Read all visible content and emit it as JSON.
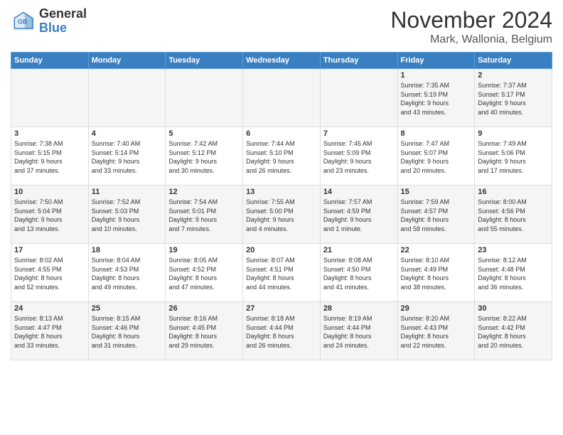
{
  "header": {
    "logo_line1": "General",
    "logo_line2": "Blue",
    "title": "November 2024",
    "subtitle": "Mark, Wallonia, Belgium"
  },
  "calendar": {
    "headers": [
      "Sunday",
      "Monday",
      "Tuesday",
      "Wednesday",
      "Thursday",
      "Friday",
      "Saturday"
    ],
    "weeks": [
      [
        {
          "day": "",
          "info": ""
        },
        {
          "day": "",
          "info": ""
        },
        {
          "day": "",
          "info": ""
        },
        {
          "day": "",
          "info": ""
        },
        {
          "day": "",
          "info": ""
        },
        {
          "day": "1",
          "info": "Sunrise: 7:35 AM\nSunset: 5:19 PM\nDaylight: 9 hours\nand 43 minutes."
        },
        {
          "day": "2",
          "info": "Sunrise: 7:37 AM\nSunset: 5:17 PM\nDaylight: 9 hours\nand 40 minutes."
        }
      ],
      [
        {
          "day": "3",
          "info": "Sunrise: 7:38 AM\nSunset: 5:15 PM\nDaylight: 9 hours\nand 37 minutes."
        },
        {
          "day": "4",
          "info": "Sunrise: 7:40 AM\nSunset: 5:14 PM\nDaylight: 9 hours\nand 33 minutes."
        },
        {
          "day": "5",
          "info": "Sunrise: 7:42 AM\nSunset: 5:12 PM\nDaylight: 9 hours\nand 30 minutes."
        },
        {
          "day": "6",
          "info": "Sunrise: 7:44 AM\nSunset: 5:10 PM\nDaylight: 9 hours\nand 26 minutes."
        },
        {
          "day": "7",
          "info": "Sunrise: 7:45 AM\nSunset: 5:09 PM\nDaylight: 9 hours\nand 23 minutes."
        },
        {
          "day": "8",
          "info": "Sunrise: 7:47 AM\nSunset: 5:07 PM\nDaylight: 9 hours\nand 20 minutes."
        },
        {
          "day": "9",
          "info": "Sunrise: 7:49 AM\nSunset: 5:06 PM\nDaylight: 9 hours\nand 17 minutes."
        }
      ],
      [
        {
          "day": "10",
          "info": "Sunrise: 7:50 AM\nSunset: 5:04 PM\nDaylight: 9 hours\nand 13 minutes."
        },
        {
          "day": "11",
          "info": "Sunrise: 7:52 AM\nSunset: 5:03 PM\nDaylight: 9 hours\nand 10 minutes."
        },
        {
          "day": "12",
          "info": "Sunrise: 7:54 AM\nSunset: 5:01 PM\nDaylight: 9 hours\nand 7 minutes."
        },
        {
          "day": "13",
          "info": "Sunrise: 7:55 AM\nSunset: 5:00 PM\nDaylight: 9 hours\nand 4 minutes."
        },
        {
          "day": "14",
          "info": "Sunrise: 7:57 AM\nSunset: 4:59 PM\nDaylight: 9 hours\nand 1 minute."
        },
        {
          "day": "15",
          "info": "Sunrise: 7:59 AM\nSunset: 4:57 PM\nDaylight: 8 hours\nand 58 minutes."
        },
        {
          "day": "16",
          "info": "Sunrise: 8:00 AM\nSunset: 4:56 PM\nDaylight: 8 hours\nand 55 minutes."
        }
      ],
      [
        {
          "day": "17",
          "info": "Sunrise: 8:02 AM\nSunset: 4:55 PM\nDaylight: 8 hours\nand 52 minutes."
        },
        {
          "day": "18",
          "info": "Sunrise: 8:04 AM\nSunset: 4:53 PM\nDaylight: 8 hours\nand 49 minutes."
        },
        {
          "day": "19",
          "info": "Sunrise: 8:05 AM\nSunset: 4:52 PM\nDaylight: 8 hours\nand 47 minutes."
        },
        {
          "day": "20",
          "info": "Sunrise: 8:07 AM\nSunset: 4:51 PM\nDaylight: 8 hours\nand 44 minutes."
        },
        {
          "day": "21",
          "info": "Sunrise: 8:08 AM\nSunset: 4:50 PM\nDaylight: 8 hours\nand 41 minutes."
        },
        {
          "day": "22",
          "info": "Sunrise: 8:10 AM\nSunset: 4:49 PM\nDaylight: 8 hours\nand 38 minutes."
        },
        {
          "day": "23",
          "info": "Sunrise: 8:12 AM\nSunset: 4:48 PM\nDaylight: 8 hours\nand 36 minutes."
        }
      ],
      [
        {
          "day": "24",
          "info": "Sunrise: 8:13 AM\nSunset: 4:47 PM\nDaylight: 8 hours\nand 33 minutes."
        },
        {
          "day": "25",
          "info": "Sunrise: 8:15 AM\nSunset: 4:46 PM\nDaylight: 8 hours\nand 31 minutes."
        },
        {
          "day": "26",
          "info": "Sunrise: 8:16 AM\nSunset: 4:45 PM\nDaylight: 8 hours\nand 29 minutes."
        },
        {
          "day": "27",
          "info": "Sunrise: 8:18 AM\nSunset: 4:44 PM\nDaylight: 8 hours\nand 26 minutes."
        },
        {
          "day": "28",
          "info": "Sunrise: 8:19 AM\nSunset: 4:44 PM\nDaylight: 8 hours\nand 24 minutes."
        },
        {
          "day": "29",
          "info": "Sunrise: 8:20 AM\nSunset: 4:43 PM\nDaylight: 8 hours\nand 22 minutes."
        },
        {
          "day": "30",
          "info": "Sunrise: 8:22 AM\nSunset: 4:42 PM\nDaylight: 8 hours\nand 20 minutes."
        }
      ]
    ]
  }
}
